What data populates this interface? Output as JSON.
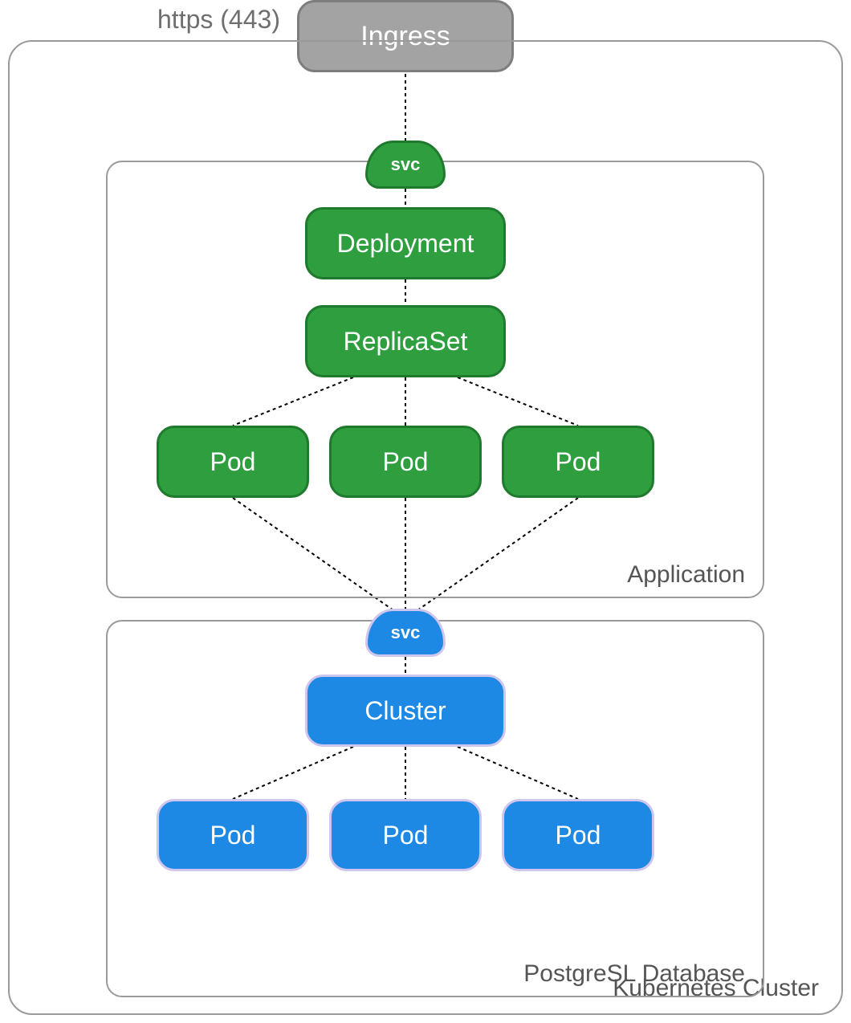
{
  "protocol_label": "https (443)",
  "ingress": {
    "label": "Ingress"
  },
  "kubernetes_cluster": {
    "label": "Kubernetes Cluster"
  },
  "application": {
    "label": "Application",
    "svc": "svc",
    "deployment": "Deployment",
    "replicaset": "ReplicaSet",
    "pods": [
      "Pod",
      "Pod",
      "Pod"
    ]
  },
  "database": {
    "label": "PostgreSL Database",
    "svc": "svc",
    "cluster": "Cluster",
    "pods": [
      "Pod",
      "Pod",
      "Pod"
    ]
  },
  "colors": {
    "gray_border": "#9a9a9a",
    "ingress_fill": "#a3a3a3",
    "ingress_border": "#7d7d7d",
    "green_fill": "#2e9e3f",
    "green_border": "#1f7a2d",
    "blue_fill": "#1d89e4",
    "blue_border": "#cfc6ee"
  }
}
